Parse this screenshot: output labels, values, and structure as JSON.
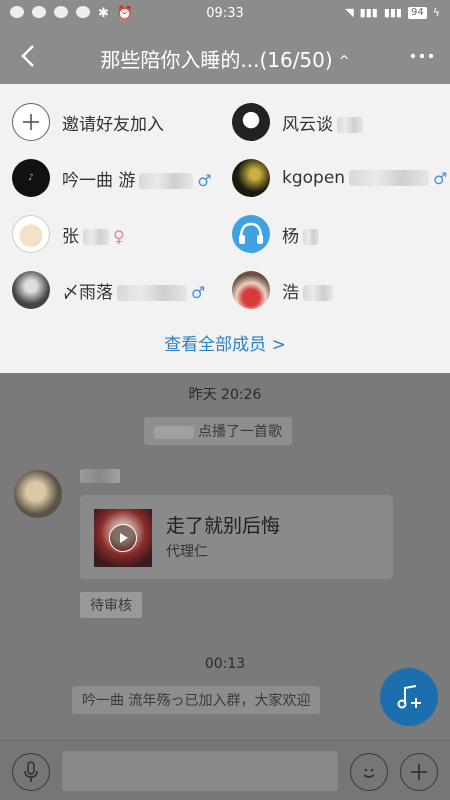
{
  "status_bar": {
    "time": "09:33",
    "battery": "94"
  },
  "header": {
    "title": "那些陪你入睡的...(16/50)",
    "caret": "^"
  },
  "members": {
    "invite_label": "邀请好友加入",
    "items": [
      {
        "name": "风云谈",
        "gender": "male",
        "avatar": "avatar-bw-face"
      },
      {
        "name": "吟一曲 游",
        "gender": "male",
        "avatar": "avatar-dark-text"
      },
      {
        "name": "kgopen",
        "gender": "male",
        "avatar": "avatar-yellow-night"
      },
      {
        "name": "张",
        "gender": "female",
        "avatar": "avatar-cartoon"
      },
      {
        "name": "杨",
        "gender": "",
        "avatar": "avatar-headphones"
      },
      {
        "name": "〆雨落",
        "gender": "male",
        "avatar": "avatar-gray-person"
      },
      {
        "name": "浩",
        "gender": "",
        "avatar": "avatar-girl-apple"
      }
    ],
    "view_all": "查看全部成员 >"
  },
  "chat": {
    "timestamp1": "昨天 20:26",
    "system_msg1": "点播了一首歌",
    "song": {
      "title": "走了就别后悔",
      "artist": "代理仁"
    },
    "pending_label": "待审核",
    "timestamp2": "00:13",
    "system_msg2": "吟一曲 流年殇っ已加入群，大家欢迎"
  },
  "colors": {
    "accent": "#2d7fc4",
    "fab": "#1b6fae"
  },
  "icons": [
    "back-icon",
    "more-icon",
    "plus-icon",
    "male-icon",
    "female-icon",
    "music-add-icon",
    "microphone-icon",
    "emoji-icon",
    "add-icon",
    "play-icon"
  ]
}
